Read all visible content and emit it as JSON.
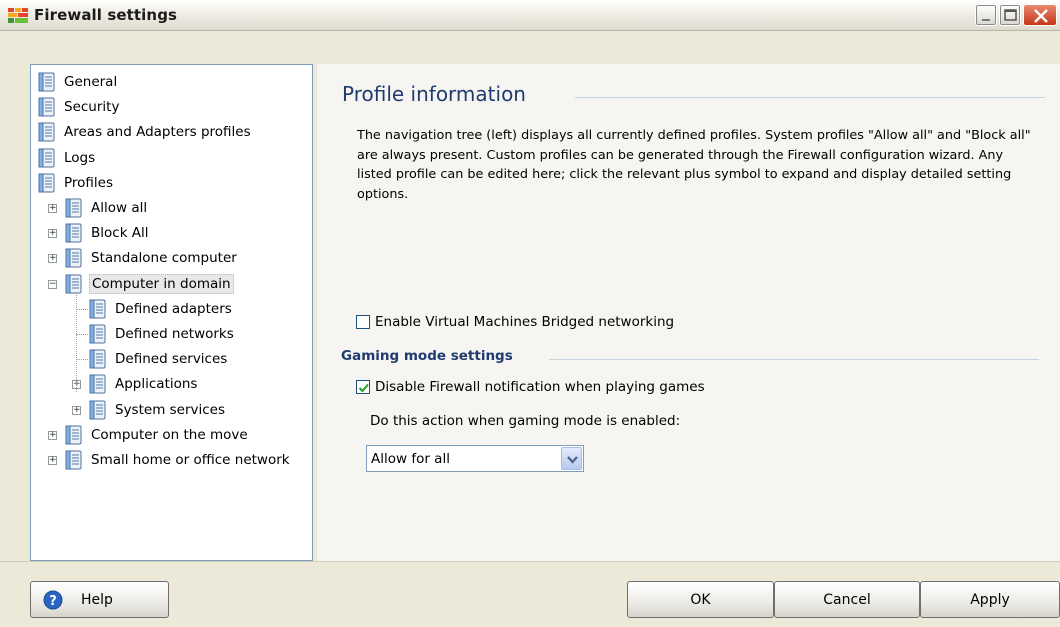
{
  "window": {
    "title": "Firewall settings"
  },
  "tree": {
    "items": [
      {
        "label": "General",
        "level": 0
      },
      {
        "label": "Security",
        "level": 0
      },
      {
        "label": "Areas and Adapters profiles",
        "level": 0
      },
      {
        "label": "Logs",
        "level": 0
      },
      {
        "label": "Profiles",
        "level": 0
      },
      {
        "label": "Allow all",
        "level": 1,
        "expander": "+"
      },
      {
        "label": "Block All",
        "level": 1,
        "expander": "+"
      },
      {
        "label": "Standalone computer",
        "level": 1,
        "expander": "+"
      },
      {
        "label": "Computer in domain",
        "level": 1,
        "expander": "-",
        "selected": true
      },
      {
        "label": "Defined adapters",
        "level": 2
      },
      {
        "label": "Defined networks",
        "level": 2
      },
      {
        "label": "Defined services",
        "level": 2
      },
      {
        "label": "Applications",
        "level": 2,
        "expander": "+"
      },
      {
        "label": "System services",
        "level": 2,
        "expander": "+"
      },
      {
        "label": "Computer on the move",
        "level": 1,
        "expander": "+"
      },
      {
        "label": "Small home or office network",
        "level": 1,
        "expander": "+"
      }
    ]
  },
  "main": {
    "title": "Profile information",
    "description": "The navigation tree (left) displays all currently defined profiles. System profiles \"Allow all\" and \"Block all\" are always present. Custom profiles can be generated through the Firewall configuration wizard. Any listed profile can be edited here; click the relevant plus symbol to expand and display detailed setting options.",
    "vm_bridged": {
      "label": "Enable Virtual Machines Bridged networking",
      "checked": false
    },
    "gaming": {
      "title": "Gaming mode settings",
      "disable_notification": {
        "label": "Disable Firewall notification when playing games",
        "checked": true
      },
      "action_label": "Do this action when gaming mode is enabled:",
      "action_value": "Allow for all"
    }
  },
  "buttons": {
    "help": "Help",
    "ok": "OK",
    "cancel": "Cancel",
    "apply": "Apply"
  },
  "colors": {
    "accent_title": "#1f3b6f",
    "panel_border": "#7f9db9",
    "close_button": "#c3361a"
  }
}
